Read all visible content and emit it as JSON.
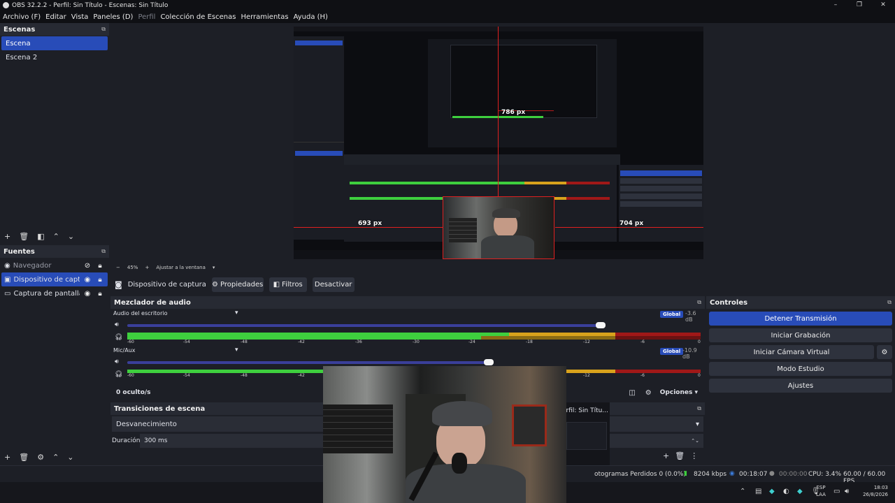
{
  "window": {
    "title": "OBS 32.2.2 - Perfil: Sin Título - Escenas: Sin Título",
    "controls": [
      "–",
      "❐",
      "✕"
    ]
  },
  "menu": [
    {
      "label": "Archivo (F)",
      "dim": false
    },
    {
      "label": "Editar",
      "dim": false
    },
    {
      "label": "Vista",
      "dim": false
    },
    {
      "label": "Paneles (D)",
      "dim": false
    },
    {
      "label": "Perfil",
      "dim": true
    },
    {
      "label": "Colección de Escenas",
      "dim": false
    },
    {
      "label": "Herramientas",
      "dim": false
    },
    {
      "label": "Ayuda (H)",
      "dim": false
    }
  ],
  "scenes": {
    "title": "Escenas",
    "items": [
      "Escena",
      "Escena 2"
    ],
    "selected": 0
  },
  "sources": {
    "title": "Fuentes",
    "items": [
      {
        "label": "Navegador",
        "visible": false,
        "selected": false
      },
      {
        "label": "Dispositivo de captura c",
        "visible": true,
        "selected": true
      },
      {
        "label": "Captura de pantalla",
        "visible": true,
        "selected": false
      }
    ]
  },
  "preview": {
    "zoom_minus": "−",
    "zoom": "45%",
    "zoom_plus": "+",
    "fit_label": "Ajustar a la ventana",
    "measure_top": "786 px",
    "measure_left": "693 px",
    "measure_right": "704 px"
  },
  "source_toolbar": {
    "source_name": "Dispositivo de captura de v",
    "properties": "Propiedades",
    "filters": "Filtros",
    "deactivate": "Desactivar"
  },
  "mixer": {
    "title": "Mezclador de audio",
    "channels": [
      {
        "name": "Audio del escritorio",
        "badge": "Global",
        "db": "-3.6 dB",
        "volume": 0.95
      },
      {
        "name": "Mic/Aux",
        "badge": "Global",
        "db": "-10.9 dB",
        "volume": 0.7
      }
    ],
    "ticks": [
      "-60",
      "-54",
      "-48",
      "-42",
      "-36",
      "-30",
      "-24",
      "-18",
      "-12",
      "-6",
      "0"
    ],
    "hidden": "0 oculto/s",
    "options": "Opciones"
  },
  "transitions": {
    "title": "Transiciones de escena",
    "selected": "Desvanecimiento",
    "duration_label": "Duración",
    "duration_value": "300 ms",
    "overlay_text": "erfil: Sin Títu..."
  },
  "controls": {
    "title": "Controles",
    "buttons": [
      "Detener Transmisión",
      "Iniciar Grabación",
      "Iniciar Cámara Virtual",
      "Modo Estudio",
      "Ajustes"
    ]
  },
  "status": {
    "dropped": "otogramas Perdidos 0 (0.0%)",
    "bitrate": "8204 kbps",
    "stream_time": "00:18:07",
    "rec_time": "00:00:00",
    "cpu": "CPU: 3.4%",
    "fps": "60.00 / 60.00 FPS"
  },
  "taskbar": {
    "lang1": "ESP",
    "lang2": "LAA",
    "time": "18:03",
    "date": "26/8/2026"
  },
  "colors": {
    "accent": "#284cb8",
    "meter_green": "#3ecf3e",
    "meter_yellow": "#d8a21c",
    "meter_red": "#a01818",
    "measure_line": "#e02020"
  }
}
